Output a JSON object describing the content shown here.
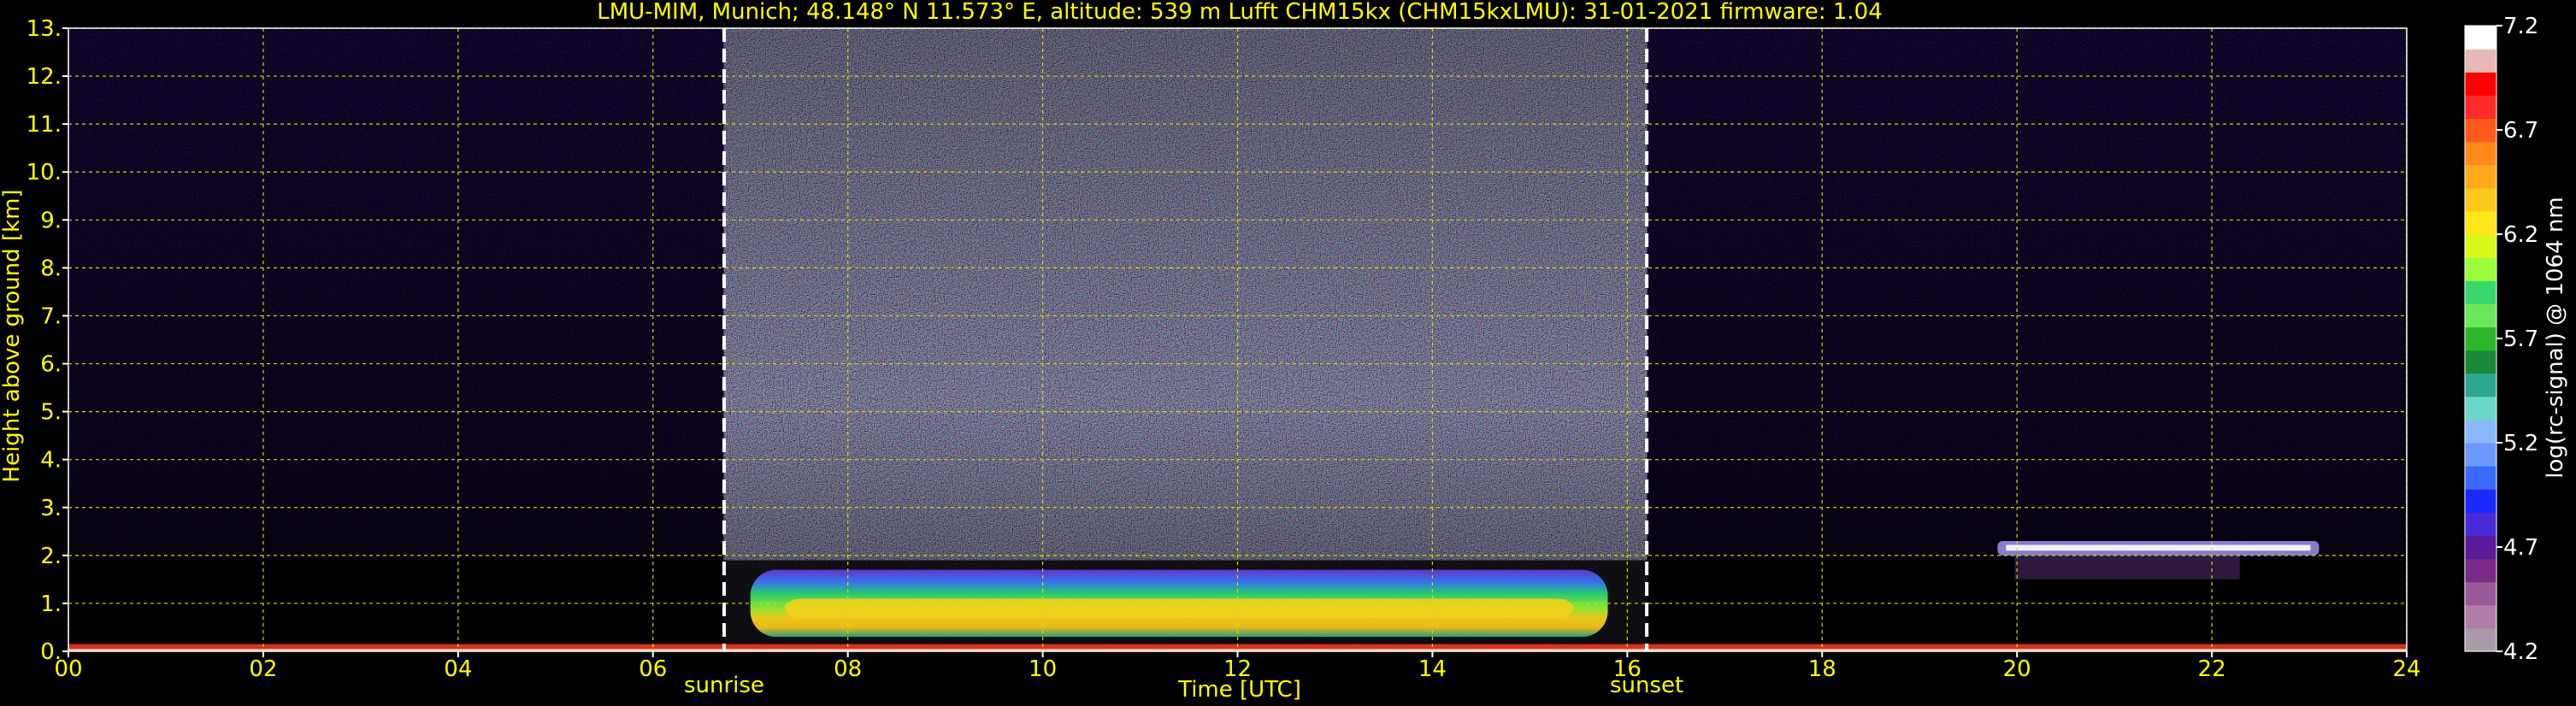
{
  "chart_data": {
    "type": "heatmap",
    "title": "LMU-MIM, Munich; 48.148° N 11.573° E, altitude: 539 m    Lufft CHM15kx (CHM15kxLMU): 31-01-2021    firmware: 1.04",
    "xlabel": "Time [UTC]",
    "ylabel": "Height above ground [km]",
    "x_ticks": [
      "00",
      "02",
      "04",
      "06",
      "08",
      "10",
      "12",
      "14",
      "16",
      "18",
      "20",
      "22",
      "24"
    ],
    "x_tick_values": [
      0,
      2,
      4,
      6,
      8,
      10,
      12,
      14,
      16,
      18,
      20,
      22,
      24
    ],
    "y_ticks": [
      "0.",
      "1.",
      "2.",
      "3.",
      "4.",
      "5.",
      "6.",
      "7.",
      "8.",
      "9.",
      "10.",
      "11.",
      "12.",
      "13."
    ],
    "y_tick_values": [
      0,
      1,
      2,
      3,
      4,
      5,
      6,
      7,
      8,
      9,
      10,
      11,
      12,
      13
    ],
    "xlim": [
      0,
      24
    ],
    "ylim": [
      0,
      13
    ],
    "grid": true,
    "colorbar": {
      "label": "log(rc-signal) @ 1064 nm",
      "ticks": [
        "4.2",
        "4.7",
        "5.2",
        "5.7",
        "6.2",
        "6.7",
        "7.2"
      ],
      "tick_values": [
        4.2,
        4.7,
        5.2,
        5.7,
        6.2,
        6.7,
        7.2
      ],
      "range": [
        4.2,
        7.2
      ],
      "colors": [
        "#a89aa8",
        "#b07ea8",
        "#9a5a9a",
        "#7a2a86",
        "#5a1a9a",
        "#4a2ad6",
        "#1a2aff",
        "#3a6aff",
        "#6a9aff",
        "#8ab8ff",
        "#6ad8c8",
        "#2aa890",
        "#1a8a3a",
        "#2ab82a",
        "#6ae85a",
        "#3ad86a",
        "#9aff3a",
        "#d8f81a",
        "#ffe81a",
        "#ffc81a",
        "#ffa81a",
        "#ff8a1a",
        "#ff5a1a",
        "#ff2a2a",
        "#ff0000",
        "#e8b8b8",
        "#ffffff"
      ]
    },
    "events": [
      {
        "label": "sunrise",
        "x": 6.73
      },
      {
        "label": "sunset",
        "x": 16.2
      }
    ],
    "features": [
      {
        "name": "daytime aerosol layer",
        "x_range": [
          7.0,
          15.8
        ],
        "y_range": [
          0.3,
          1.7
        ]
      },
      {
        "name": "cloud layer",
        "x_range": [
          19.8,
          23.1
        ],
        "y_range": [
          2.0,
          2.3
        ]
      },
      {
        "name": "surface layer",
        "x_range": [
          0,
          24
        ],
        "y_range": [
          0,
          0.15
        ]
      }
    ],
    "colors": {
      "text": "#ffff00",
      "grid": "#d8d800",
      "event_line": "#ffffff",
      "background": "#000000"
    }
  }
}
